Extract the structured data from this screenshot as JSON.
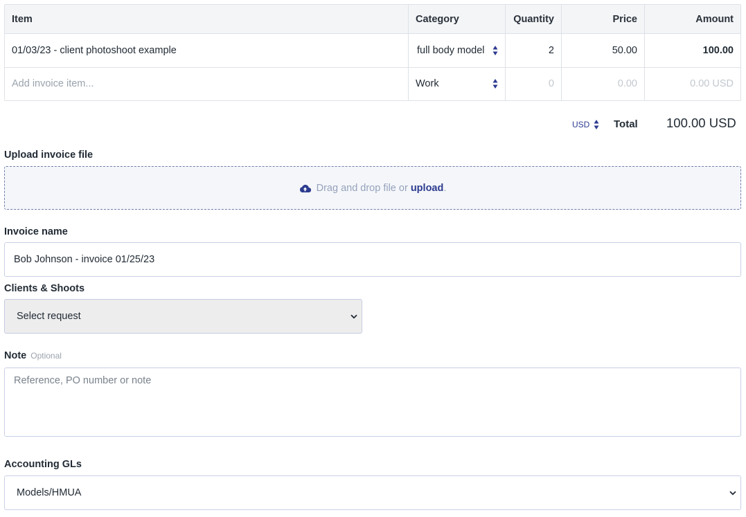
{
  "table": {
    "headers": {
      "item": "Item",
      "category": "Category",
      "quantity": "Quantity",
      "price": "Price",
      "amount": "Amount"
    },
    "rows": [
      {
        "item": "01/03/23 - client photoshoot example",
        "category": "full body model",
        "quantity": "2",
        "price": "50.00",
        "amount": "100.00"
      }
    ],
    "new_row": {
      "item_placeholder": "Add invoice item...",
      "category": "Work",
      "quantity": "0",
      "price": "0.00",
      "amount": "0.00 USD"
    }
  },
  "totals": {
    "currency": "USD",
    "label": "Total",
    "value": "100.00 USD"
  },
  "upload": {
    "label": "Upload invoice file",
    "prompt": "Drag and drop file or",
    "link": "upload",
    "suffix": "."
  },
  "invoice_name": {
    "label": "Invoice name",
    "value": "Bob Johnson - invoice 01/25/23"
  },
  "clients": {
    "label": "Clients & Shoots",
    "selected": "Select request"
  },
  "note": {
    "label": "Note",
    "optional": "Optional",
    "placeholder": "Reference, PO number or note"
  },
  "accounting": {
    "label": "Accounting GLs",
    "selected": "Models/HMUA"
  },
  "colors": {
    "accent": "#2d3b8f",
    "border": "#c9d0e6",
    "header_bg": "#f4f5f7"
  },
  "icons": {
    "upload": "cloud-upload-icon",
    "sorter": "up-down-arrows-icon",
    "dropdown": "chevron-down-icon"
  }
}
